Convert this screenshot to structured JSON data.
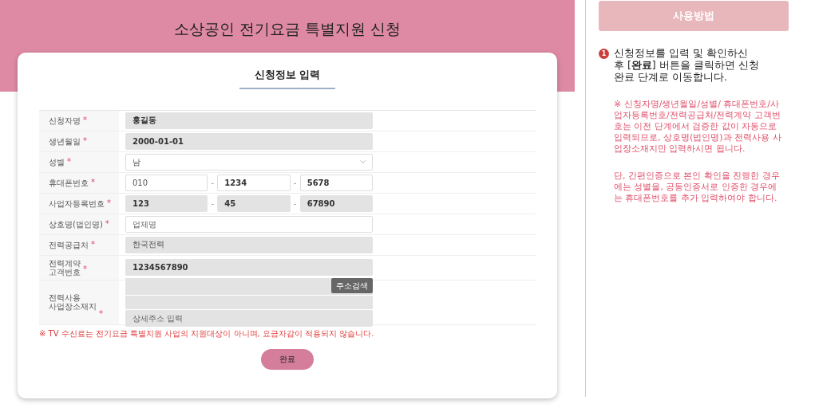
{
  "page_title": "소상공인 전기요금 특별지원 신청",
  "form": {
    "title": "신청정보 입력",
    "fields": [
      {
        "kind": "text",
        "label": "신청자명",
        "required": true,
        "value": "홍길동",
        "disabled": true
      },
      {
        "kind": "text",
        "label": "생년월일",
        "required": true,
        "value": "2000-01-01",
        "disabled": true
      },
      {
        "kind": "select",
        "label": "성별",
        "required": true,
        "value": "남",
        "disabled": false
      },
      {
        "kind": "split",
        "label": "휴대폰번호",
        "required": true,
        "separator": "-",
        "parts": [
          {
            "value": "010",
            "disabled": false
          },
          {
            "value": "1234",
            "disabled": false
          },
          {
            "value": "5678",
            "disabled": false
          }
        ]
      },
      {
        "kind": "split",
        "label": "사업자등록번호",
        "required": true,
        "separator": "-",
        "parts": [
          {
            "value": "123",
            "disabled": true
          },
          {
            "value": "45",
            "disabled": true
          },
          {
            "value": "67890",
            "disabled": true
          }
        ]
      },
      {
        "kind": "text",
        "label": "상호명(법인명)",
        "required": true,
        "placeholder": "업체명",
        "disabled": false
      },
      {
        "kind": "text",
        "label": "전력공급처",
        "required": true,
        "value": "한국전력",
        "disabled": true
      },
      {
        "kind": "text",
        "label": "전력계약\n고객번호",
        "required": true,
        "value": "1234567890",
        "disabled": true
      },
      {
        "kind": "address",
        "label": "전력사용\n사업장소재지",
        "required": true,
        "search_button": "주소검색",
        "detail_placeholder": "상세주소 입력"
      }
    ],
    "required_mark": "*",
    "notice": "※ TV 수신료는 전기요금 특별지원 사업의 지원대상이 아니며, 요금차감이 적용되지 않습니다.",
    "submit_button": "완료"
  },
  "guide": {
    "title": "사용방법",
    "steps": [
      {
        "number": "1",
        "text": "신청정보를 입력 및 확인하신 후 [**완료**] 버튼을 클릭하면 신청 완료 단계로 이동합니다."
      }
    ],
    "notes": [
      "※ 신청자명/생년월일/성별/ 휴대폰번호/사업자등록번호/전력공급처/전력계약 고객번호는 이전 단계에서 검증한 값이 자동으로 입력되므로, 상호명(법인명)과 전력사용 사업장소재지만 입력하시면 됩니다.",
      "단, 간편인증으로 본인 확인을 진행한 경우에는 성별을, 공동인증서로 인증한 경우에는 휴대폰번호를 추가 입력하여야 합니다."
    ]
  }
}
